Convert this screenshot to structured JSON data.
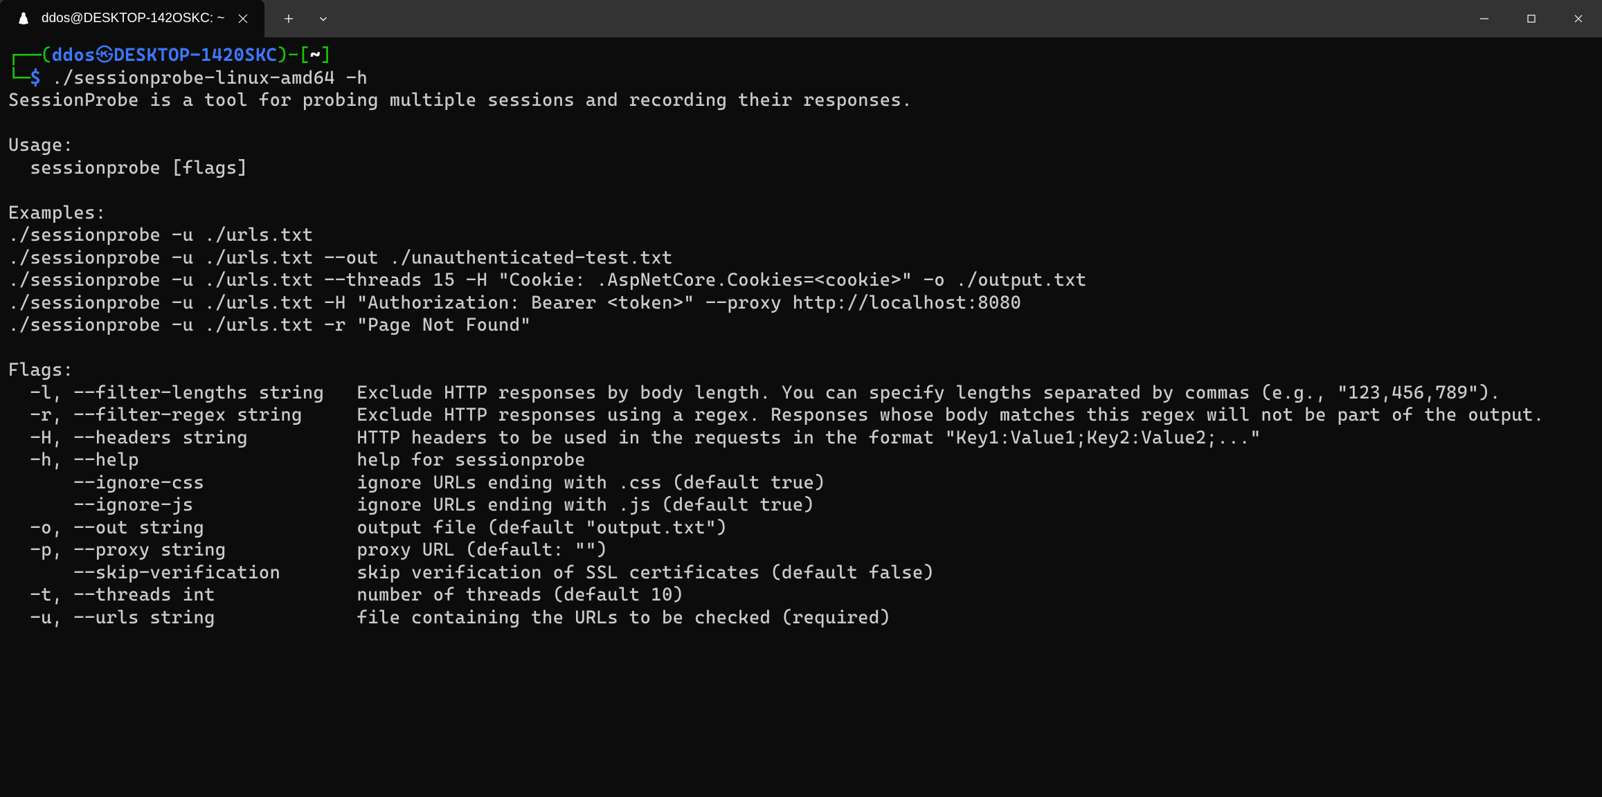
{
  "titlebar": {
    "tab_title": "ddos@DESKTOP-142OSKC: ~"
  },
  "prompt": {
    "user": "ddos",
    "host": "DESKTOP-1420SKC",
    "path": "~",
    "symbol": "$",
    "open1": "┌──(",
    "at_sep": "㉿",
    "mid": ")-[",
    "close1": "]",
    "open2": "└─"
  },
  "command": "./sessionprobe-linux-amd64 -h",
  "output": {
    "description": "SessionProbe is a tool for probing multiple sessions and recording their responses.",
    "usage_header": "Usage:",
    "usage_line": "  sessionprobe [flags]",
    "examples_header": "Examples:",
    "examples": [
      "./sessionprobe -u ./urls.txt",
      "./sessionprobe -u ./urls.txt --out ./unauthenticated-test.txt",
      "./sessionprobe -u ./urls.txt --threads 15 -H \"Cookie: .AspNetCore.Cookies=<cookie>\" -o ./output.txt",
      "./sessionprobe -u ./urls.txt -H \"Authorization: Bearer <token>\" --proxy http://localhost:8080",
      "./sessionprobe -u ./urls.txt -r \"Page Not Found\""
    ],
    "flags_header": "Flags:",
    "flags": [
      "  -l, --filter-lengths string   Exclude HTTP responses by body length. You can specify lengths separated by commas (e.g., \"123,456,789\").",
      "  -r, --filter-regex string     Exclude HTTP responses using a regex. Responses whose body matches this regex will not be part of the output.",
      "  -H, --headers string          HTTP headers to be used in the requests in the format \"Key1:Value1;Key2:Value2;...\"",
      "  -h, --help                    help for sessionprobe",
      "      --ignore-css              ignore URLs ending with .css (default true)",
      "      --ignore-js               ignore URLs ending with .js (default true)",
      "  -o, --out string              output file (default \"output.txt\")",
      "  -p, --proxy string            proxy URL (default: \"\")",
      "      --skip-verification       skip verification of SSL certificates (default false)",
      "  -t, --threads int             number of threads (default 10)",
      "  -u, --urls string             file containing the URLs to be checked (required)"
    ]
  }
}
